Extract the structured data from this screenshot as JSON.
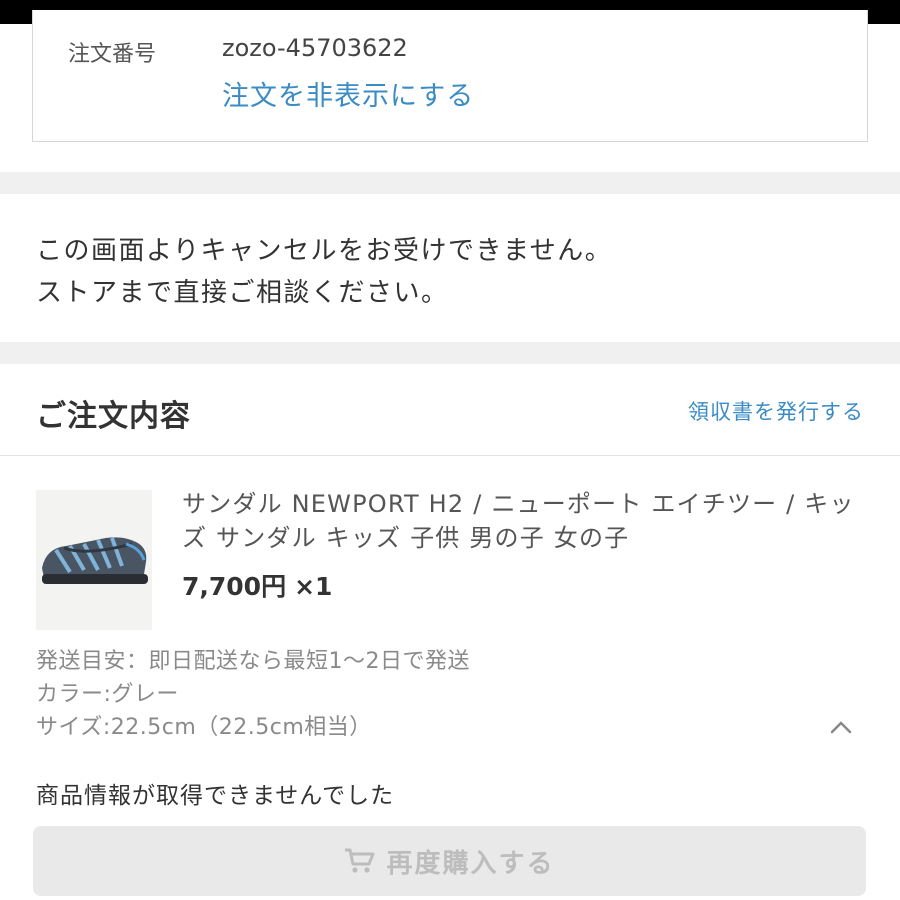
{
  "order": {
    "label": "注文番号",
    "number": "zozo-45703622",
    "hide_link": "注文を非表示にする"
  },
  "notice": {
    "line1": "この画面よりキャンセルをお受けできません。",
    "line2": "ストアまで直接ご相談ください。"
  },
  "section": {
    "title": "ご注文内容",
    "receipt_link": "領収書を発行する"
  },
  "item": {
    "name": "サンダル NEWPORT H2 / ニューポート エイチツー / キッズ サンダル キッズ 子供 男の子 女の子",
    "price": "7,700円",
    "quantity": "×1",
    "shipping": "発送目安：即日配送なら最短1〜2日で発送",
    "color": "カラー:グレー",
    "size": "サイズ:22.5cm（22.5cm相当）",
    "unavailable_message": "商品情報が取得できませんでした",
    "rebuy_label": "再度購入する"
  },
  "icons": {
    "cart": "cart-icon",
    "chevron": "chevron-up-icon"
  },
  "colors": {
    "link": "#3b8cc4",
    "disabled_text": "#bdbdbd",
    "disabled_bg": "#e9e9e9",
    "divider": "#f0f0f0"
  }
}
